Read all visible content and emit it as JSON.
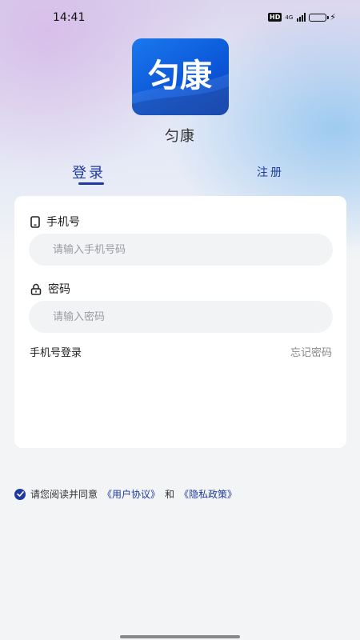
{
  "status_bar": {
    "time": "14:41",
    "hd_badge": "HD",
    "network": "4G",
    "battery_color": "#f2c94c"
  },
  "app": {
    "logo_text": "匀康",
    "name": "匀康",
    "brand_color": "#1e3aa0",
    "logo_color": "#0b55d6"
  },
  "tabs": {
    "login": "登录",
    "register": "注册"
  },
  "form": {
    "phone_label": "手机号",
    "phone_icon": "phone-icon",
    "phone_placeholder": "请输入手机号码",
    "phone_value": "",
    "password_label": "密码",
    "password_icon": "lock-icon",
    "password_placeholder": "请输入密码",
    "password_value": "",
    "sms_login": "手机号登录",
    "forgot_password": "忘记密码"
  },
  "agreement": {
    "prefix": "请您阅读并同意",
    "user_agreement": "《用户协议》",
    "conjunction": "和",
    "privacy_policy": "《隐私政策》",
    "checked": true
  }
}
